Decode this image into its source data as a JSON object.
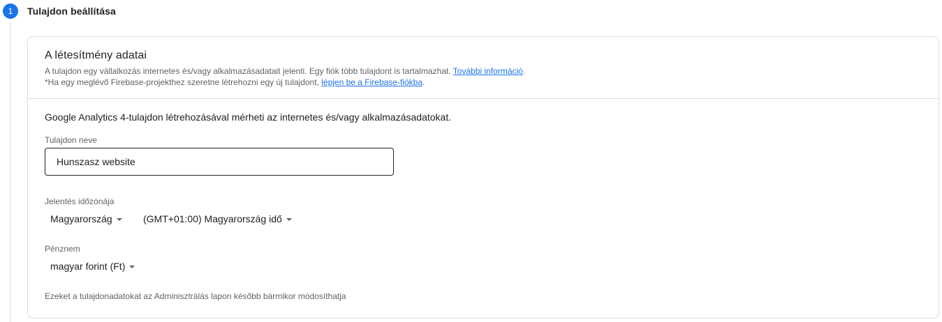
{
  "step": {
    "number": "1",
    "title": "Tulajdon beállítása"
  },
  "card": {
    "title": "A létesítmény adatai",
    "desc_line1": "A tulajdon egy vállalkozás internetes és/vagy alkalmazásadatait jelenti. Egy fiók több tulajdont is tartalmazhat.",
    "desc_link1": "További információ",
    "desc_line1_end": ".",
    "desc_line2": "*Ha egy meglévő Firebase-projekthez szeretne létrehozni egy új tulajdont,",
    "desc_link2": "lépjen be a Firebase-fiókba",
    "desc_line2_end": "."
  },
  "form": {
    "intro": "Google Analytics 4-tulajdon létrehozásával mérheti az internetes és/vagy alkalmazásadatokat.",
    "property_name_label": "Tulajdon neve",
    "property_name_value": "Hunszasz website",
    "timezone_label": "Jelentés időzónája",
    "country_value": "Magyarország",
    "timezone_value": "(GMT+01:00) Magyarország idő",
    "currency_label": "Pénznem",
    "currency_value": "magyar forint (Ft)",
    "footnote": "Ezeket a tulajdonadatokat az Adminisztrálás lapon később bármikor módosíthatja"
  },
  "colors": {
    "accent": "#1a73e8",
    "text": "#202124",
    "secondary_text": "#5f6368",
    "border": "#dadce0"
  }
}
